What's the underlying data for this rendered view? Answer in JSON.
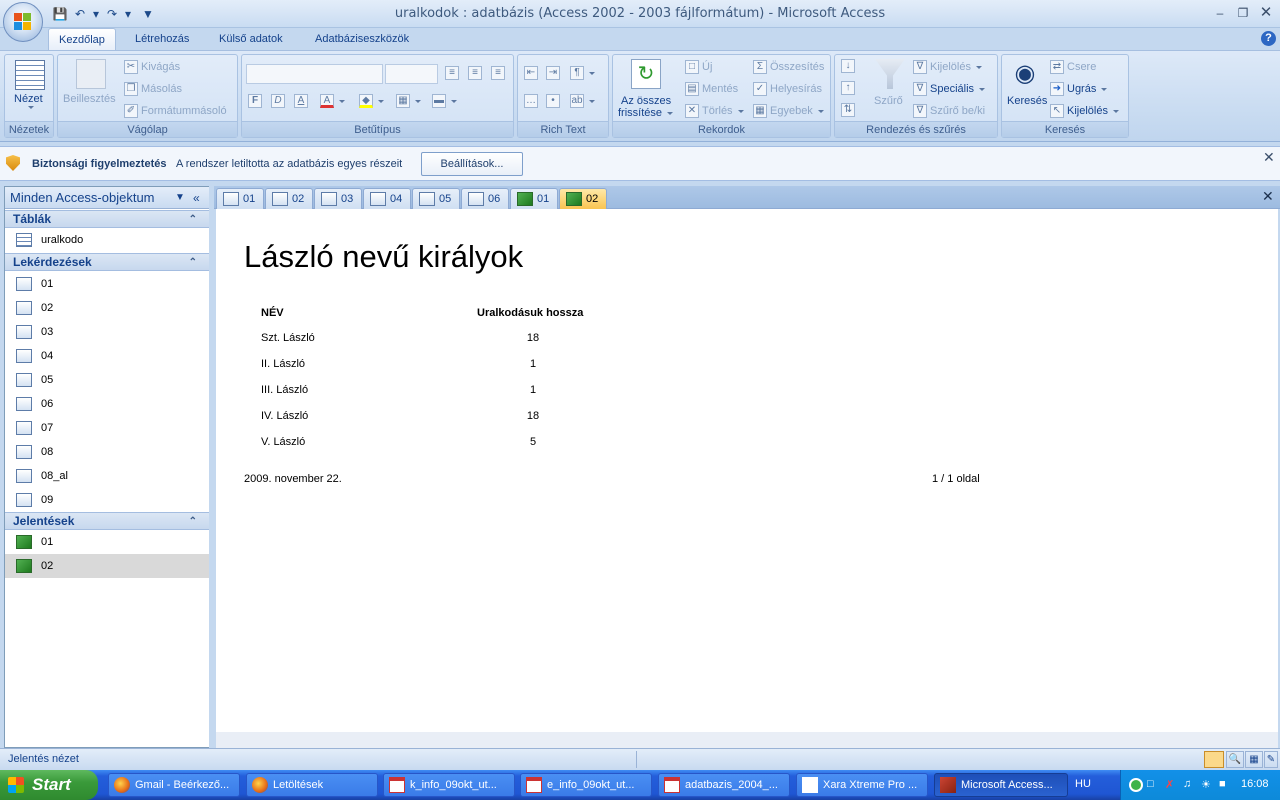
{
  "window": {
    "title": "uralkodok : adatbázis (Access 2002 - 2003 fájlformátum) - Microsoft Access"
  },
  "ribbon": {
    "tabs": [
      {
        "label": "Kezdőlap"
      },
      {
        "label": "Létrehozás"
      },
      {
        "label": "Külső adatok"
      },
      {
        "label": "Adatbáziseszközök"
      }
    ],
    "groups": {
      "nezetek": {
        "label": "Nézetek",
        "view_button": "Nézet"
      },
      "vagolap": {
        "label": "Vágólap",
        "paste": "Beillesztés",
        "cut": "Kivágás",
        "copy": "Másolás",
        "format_painter": "Formátummásoló"
      },
      "betutipus": {
        "label": "Betűtípus",
        "bold": "F",
        "italic": "D",
        "underline": "A"
      },
      "richtext": {
        "label": "Rich Text"
      },
      "rekordok": {
        "label": "Rekordok",
        "refresh_line1": "Az összes",
        "refresh_line2": "frissítése",
        "new": "Új",
        "save": "Mentés",
        "delete": "Törlés",
        "totals": "Összesítés",
        "spelling": "Helyesírás",
        "more": "Egyebek"
      },
      "rendezes": {
        "label": "Rendezés és szűrés",
        "filter": "Szűrő",
        "selection": "Kijelölés",
        "advanced": "Speciális",
        "toggle": "Szűrő be/ki"
      },
      "kereses": {
        "label": "Keresés",
        "find": "Keresés",
        "replace": "Csere",
        "goto": "Ugrás",
        "select": "Kijelölés"
      }
    }
  },
  "security_bar": {
    "title": "Biztonsági figyelmeztetés",
    "message": "A rendszer letiltotta az adatbázis egyes részeit",
    "button": "Beállítások..."
  },
  "nav": {
    "header": "Minden Access-objektum",
    "sections": {
      "tables": {
        "label": "Táblák",
        "items": [
          "uralkodo"
        ]
      },
      "queries": {
        "label": "Lekérdezések",
        "items": [
          "01",
          "02",
          "03",
          "04",
          "05",
          "06",
          "07",
          "08",
          "08_al",
          "09"
        ]
      },
      "reports": {
        "label": "Jelentések",
        "items": [
          "01",
          "02"
        ]
      }
    }
  },
  "doc_tabs": [
    "01",
    "02",
    "03",
    "04",
    "05",
    "06",
    "01",
    "02"
  ],
  "report": {
    "title": "László nevű királyok",
    "columns": [
      "NÉV",
      "Uralkodásuk hossza"
    ],
    "rows": [
      {
        "name": "Szt. László",
        "value": "18"
      },
      {
        "name": "II. László",
        "value": "1"
      },
      {
        "name": "III. László",
        "value": "1"
      },
      {
        "name": "IV. László",
        "value": "18"
      },
      {
        "name": "V. László",
        "value": "5"
      }
    ],
    "date": "2009. november 22.",
    "page": "1 / 1 oldal"
  },
  "status_bar": {
    "text": "Jelentés nézet"
  },
  "taskbar": {
    "start": "Start",
    "items": [
      {
        "label": "Gmail - Beérkező..."
      },
      {
        "label": "Letöltések"
      },
      {
        "label": "k_info_09okt_ut..."
      },
      {
        "label": "e_info_09okt_ut..."
      },
      {
        "label": "adatbazis_2004_..."
      },
      {
        "label": "Xara Xtreme Pro ..."
      },
      {
        "label": "Microsoft Access..."
      }
    ],
    "language": "HU",
    "clock": "16:08"
  }
}
